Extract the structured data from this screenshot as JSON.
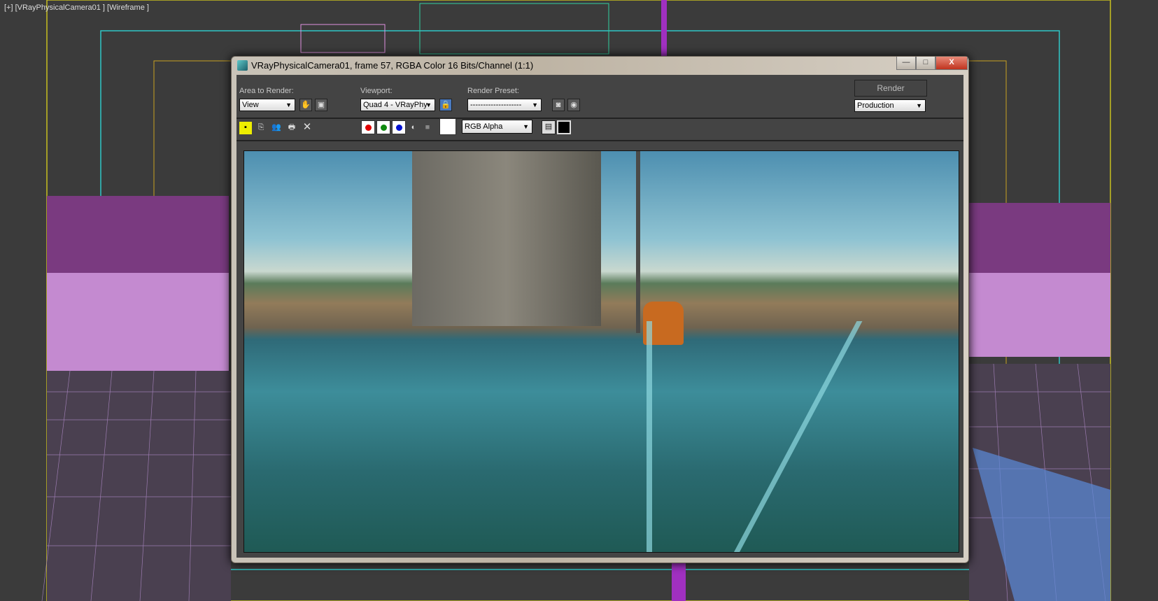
{
  "viewport": {
    "label": "[+] [VRayPhysicalCamera01 ] [Wireframe ]"
  },
  "dialog": {
    "title": "VRayPhysicalCamera01, frame 57, RGBA Color 16 Bits/Channel (1:1)",
    "window_buttons": {
      "minimize": "—",
      "maximize": "□",
      "close": "X"
    },
    "area_to_render": {
      "label": "Area to Render:",
      "value": "View"
    },
    "viewport": {
      "label": "Viewport:",
      "value": "Quad 4 - VRayPhy"
    },
    "render_preset": {
      "label": "Render Preset:",
      "value": "--------------------"
    },
    "render_button": "Render",
    "render_mode": "Production",
    "channel": "RGB Alpha",
    "channel_colors": {
      "red": "#e00000",
      "green": "#108a10",
      "blue": "#0010d0"
    }
  }
}
